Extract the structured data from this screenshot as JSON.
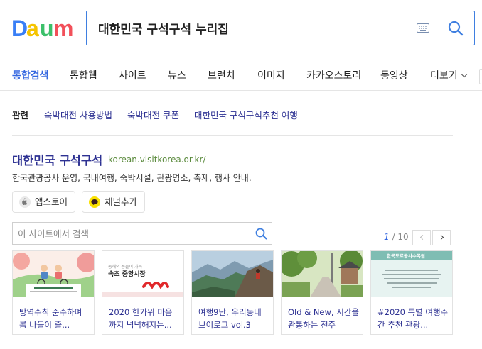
{
  "logo": {
    "alt": "Daum"
  },
  "search": {
    "query": "대한민국 구석구석 누리집"
  },
  "tabs": [
    {
      "label": "통합검색",
      "active": true
    },
    {
      "label": "통합웹"
    },
    {
      "label": "사이트"
    },
    {
      "label": "뉴스"
    },
    {
      "label": "브런치"
    },
    {
      "label": "이미지"
    },
    {
      "label": "카카오스토리"
    },
    {
      "label": "동영상"
    },
    {
      "label": "더보기"
    }
  ],
  "related": {
    "heading": "관련",
    "links": [
      "숙박대전 사용방법",
      "숙박대전 쿠폰",
      "대한민국 구석구석추천 여행"
    ]
  },
  "result": {
    "title": "대한민국 구석구석",
    "url": "korean.visitkorea.or.kr/",
    "description": "한국관광공사 운영, 국내여행, 숙박시설, 관광명소, 축제, 행사 안내.",
    "buttons": [
      {
        "label": "앱스토어",
        "icon": "apple-icon"
      },
      {
        "label": "채널추가",
        "icon": "kakaotalk-icon"
      }
    ],
    "site_search_placeholder": "이 사이트에서 검색",
    "pager": {
      "current": "1",
      "total": "10"
    }
  },
  "cards": [
    {
      "caption": "방역수칙 준수하며 봄 나들이 즐...",
      "thumb": "spring-picnic-illustration"
    },
    {
      "caption": "2020 한가위 마음까지 넉넉해지는...",
      "thumb": "sokcho-market-poster",
      "thumb_text_1": "동해의 풍물이 가득",
      "thumb_text_2": "속초 중앙시장"
    },
    {
      "caption": "여행9단, 우리동네 브이로그 vol.3",
      "thumb": "mountain-hiker-photo"
    },
    {
      "caption": "Old & New, 시간을 관통하는 전주",
      "thumb": "jeonju-street-photo"
    },
    {
      "caption": "#2020 특별 여행주간 추천 관광...",
      "thumb": "highway-corp-notice",
      "thumb_text_1": "한국도로공사수목원"
    }
  ],
  "colors": {
    "accent_blue": "#3366e0",
    "link_navy": "#2d3192",
    "url_green": "#5a8a3c",
    "search_border": "#3f7fe0"
  }
}
